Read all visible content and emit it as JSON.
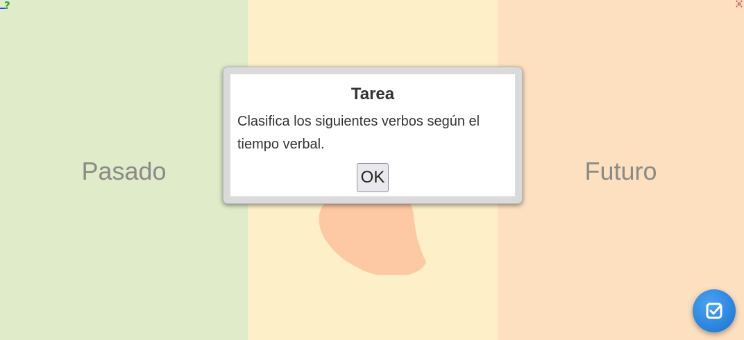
{
  "columns": [
    {
      "label": "Pasado",
      "color": "#e0ebc9"
    },
    {
      "label": "",
      "color": "#fdf0c8"
    },
    {
      "label": "Futuro",
      "color": "#fde0c0"
    }
  ],
  "modal": {
    "title": "Tarea",
    "body": "Clasifica los siguientes verbos según el tiempo verbal.",
    "ok_label": "OK"
  },
  "icons": {
    "help": "help-icon",
    "close": "close-icon",
    "check": "check-icon"
  },
  "colors": {
    "blob": "#fdc8a4",
    "fab": "#2b86e0",
    "label_text": "#8a8a86"
  }
}
